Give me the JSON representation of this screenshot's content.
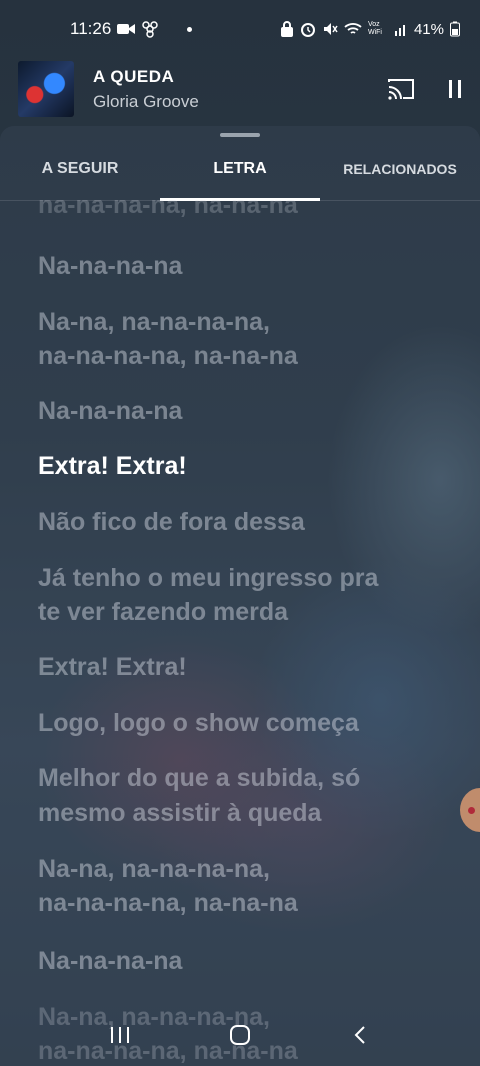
{
  "status_bar": {
    "time": "11:26",
    "battery": "41%",
    "network_label": "Voz WiFi"
  },
  "now_playing": {
    "title": "A QUEDA",
    "artist": "Gloria Groove"
  },
  "tabs": [
    {
      "label": "A SEGUIR",
      "active": false
    },
    {
      "label": "LETRA",
      "active": true
    },
    {
      "label": "RELACIONADOS",
      "active": false
    }
  ],
  "lyrics": [
    "na-na-na-na, na-na-na",
    "Na-na-na-na",
    "Na-na, na-na-na-na,",
    "na-na-na-na, na-na-na",
    "Na-na-na-na",
    "Extra! Extra!",
    "Não fico de fora dessa",
    "Já tenho o meu ingresso pra",
    "te ver fazendo merda",
    "Extra! Extra!",
    "Logo, logo o show começa",
    "Melhor do que a subida, só",
    "mesmo assistir à queda",
    "Na-na, na-na-na-na,",
    "na-na-na-na, na-na-na",
    "Na-na-na-na",
    "Na-na, na-na-na-na,",
    "na-na-na-na, na-na-na"
  ],
  "current_line_index": 5,
  "icons": {
    "cast": "cast-icon",
    "pause": "pause-icon",
    "recents": "recents-icon",
    "home": "home-icon",
    "back": "back-icon"
  }
}
